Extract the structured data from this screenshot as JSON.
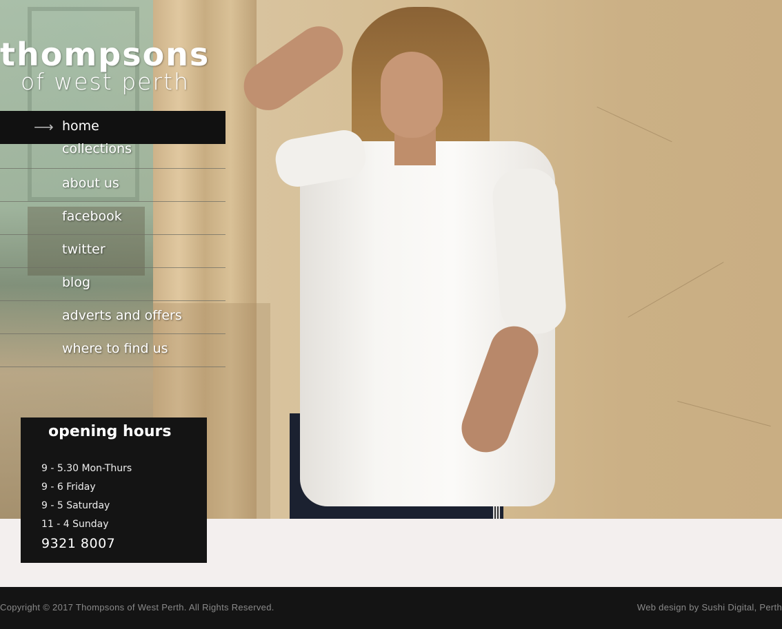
{
  "logo": {
    "line1": "thompsons",
    "line2": "of west perth"
  },
  "nav": {
    "arrow": "⟶",
    "items": [
      {
        "label": "home",
        "active": true
      },
      {
        "label": "collections"
      },
      {
        "label": "about us"
      },
      {
        "label": "facebook"
      },
      {
        "label": "twitter"
      },
      {
        "label": "blog"
      },
      {
        "label": "adverts and offers"
      },
      {
        "label": "where to find us"
      }
    ]
  },
  "hours": {
    "title": "opening hours",
    "lines": [
      "9 - 5.30 Mon-Thurs",
      "9 - 6 Friday",
      "9 - 5 Saturday",
      "11 - 4 Sunday"
    ],
    "phone": "9321 8007"
  },
  "footer": {
    "copyright": "Copyright © 2017 Thompsons of West Perth. All Rights Reserved.",
    "credit": "Web design by Sushi Digital, Perth"
  },
  "colors": {
    "nav_active_bg": "#111111",
    "box_bg": "#141414",
    "footer_bg": "#141414",
    "page_bg": "#f3efee"
  }
}
